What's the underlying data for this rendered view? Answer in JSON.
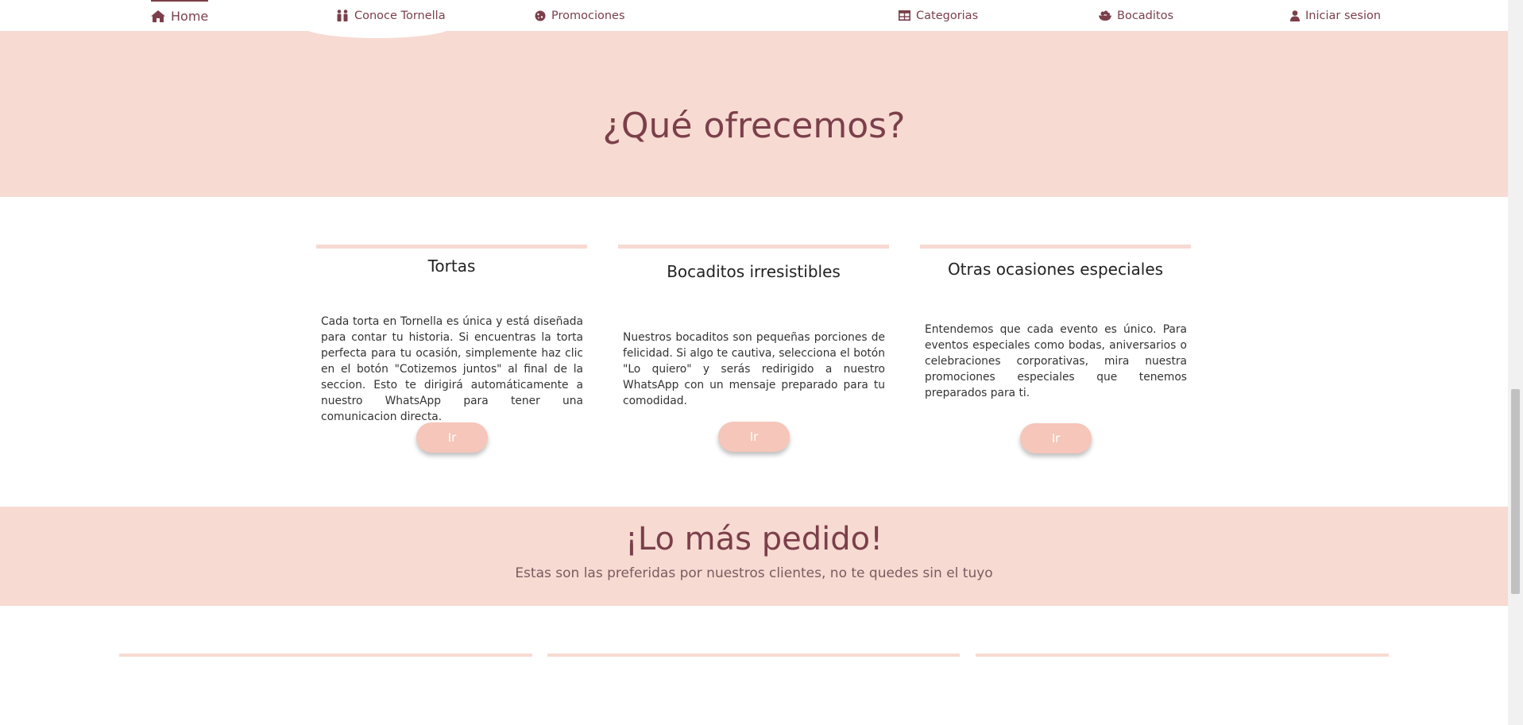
{
  "nav": {
    "items": [
      {
        "label": "Home",
        "icon": "home-icon"
      },
      {
        "label": "Conoce Tornella",
        "icon": "people-icon"
      },
      {
        "label": "Promociones",
        "icon": "cookie-icon"
      },
      {
        "label": "Categorias",
        "icon": "table-icon"
      },
      {
        "label": "Bocaditos",
        "icon": "bowl-icon"
      },
      {
        "label": "Iniciar sesion",
        "icon": "user-icon"
      }
    ]
  },
  "offer": {
    "title": "¿Qué ofrecemos?",
    "cards": [
      {
        "title": "Tortas",
        "text": "Cada torta en Tornella es única y está diseñada para contar tu historia. Si encuentras la torta perfecta para tu ocasión, simplemente haz clic en el botón \"Cotizemos juntos\" al final de la seccion. Esto te dirigirá automáticamente a nuestro WhatsApp para tener una comunicacion directa.",
        "button": "Ir"
      },
      {
        "title": "Bocaditos irresistibles",
        "text": "Nuestros bocaditos son pequeñas porciones de felicidad. Si algo te cautiva, selecciona el botón \"Lo quiero\" y serás redirigido a nuestro WhatsApp con un mensaje preparado para tu comodidad.",
        "button": "Ir"
      },
      {
        "title": "Otras ocasiones especiales",
        "text": "Entendemos que cada evento es único. Para eventos especiales como bodas, aniversarios o celebraciones corporativas, mira nuestra promociones especiales que tenemos preparados para ti.",
        "button": "Ir"
      }
    ]
  },
  "popular": {
    "title": "¡Lo más pedido!",
    "subtitle": "Estas son las preferidas por nuestros clientes, no te quedes sin el tuyo"
  },
  "colors": {
    "accent": "#7b3f4a",
    "section_bg": "#f7dad2",
    "button_bg": "#f5c6b9"
  }
}
